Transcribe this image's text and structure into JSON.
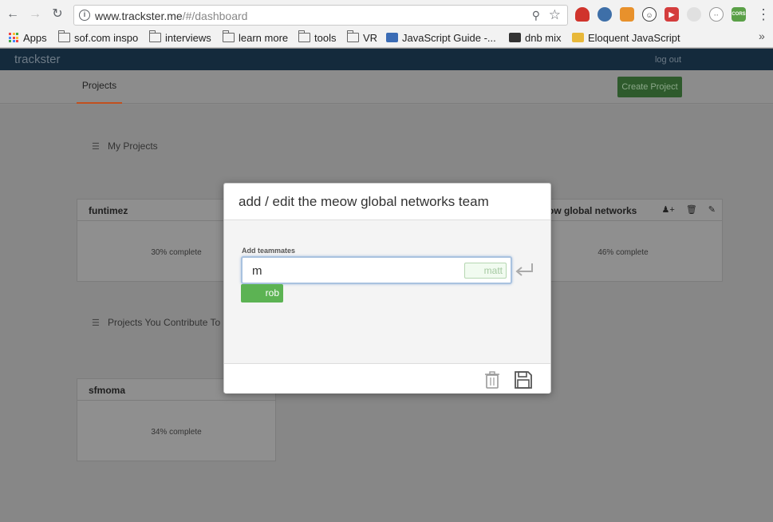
{
  "browser": {
    "url_host": "www.trackster.me",
    "url_path": "/#/dashboard",
    "bookmarks": [
      {
        "label": "Apps",
        "icon": "apps-icon"
      },
      {
        "label": "sof.com inspo",
        "icon": "folder-icon"
      },
      {
        "label": "interviews",
        "icon": "folder-icon"
      },
      {
        "label": "learn more",
        "icon": "folder-icon"
      },
      {
        "label": "tools",
        "icon": "folder-icon"
      },
      {
        "label": "VR",
        "icon": "folder-icon"
      },
      {
        "label": "JavaScript Guide -...",
        "icon": "mdn-icon"
      },
      {
        "label": "dnb mix",
        "icon": "mixcloud-icon"
      },
      {
        "label": "Eloquent JavaScript",
        "icon": "ejs-icon"
      }
    ],
    "ext_cors_label": "CORS"
  },
  "app": {
    "brand": "trackster",
    "logout": "log out",
    "tab_projects": "Projects",
    "create_project": "Create Project"
  },
  "sections": {
    "my_projects": "My Projects",
    "contribute": "Projects You Contribute To"
  },
  "cards": {
    "funtimez": {
      "title": "funtimez",
      "progress": "30% complete"
    },
    "meow": {
      "title": "ow global networks",
      "progress": "46% complete"
    },
    "sfmoma": {
      "title": "sfmoma",
      "progress": "34% complete"
    }
  },
  "modal": {
    "title": "add / edit the meow global networks team",
    "field_label": "Add teammates",
    "input_value": "m",
    "suggestion": "matt",
    "selected_member": "rob"
  },
  "colors": {
    "accent_green": "#5cb353",
    "tab_underline": "#c1501f",
    "navbar": "#142a3c"
  }
}
